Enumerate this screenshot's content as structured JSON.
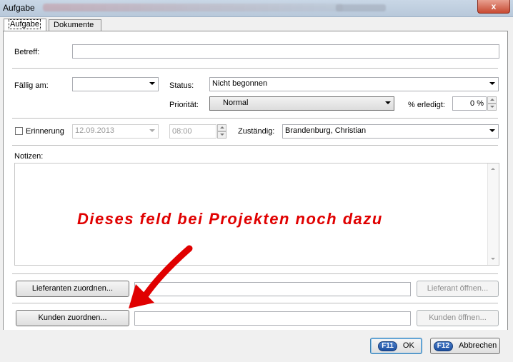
{
  "window": {
    "title": "Aufgabe",
    "close_label": "x"
  },
  "tabs": [
    {
      "label": "Aufgabe",
      "active": true
    },
    {
      "label": "Dokumente",
      "active": false
    }
  ],
  "form": {
    "betreff_label": "Betreff:",
    "betreff_value": "",
    "faellig_label": "Fällig am:",
    "faellig_value": "",
    "status_label": "Status:",
    "status_value": "Nicht begonnen",
    "prioritaet_label": "Priorität:",
    "prioritaet_value": "Normal",
    "erledigt_label": "% erledigt:",
    "erledigt_value": "0 %",
    "erinnerung_label": "Erinnerung",
    "erinnerung_checked": false,
    "erinnerung_date": "12.09.2013",
    "erinnerung_time": "08:00",
    "zustaendig_label": "Zuständig:",
    "zustaendig_value": "Brandenburg, Christian",
    "notizen_label": "Notizen:",
    "notizen_value": ""
  },
  "annotation": {
    "text": "Dieses feld bei Projekten noch dazu",
    "color": "#e00000"
  },
  "lieferanten": {
    "assign_label": "Lieferanten zuordnen...",
    "value": "",
    "open_label": "Lieferant öffnen..."
  },
  "kunden": {
    "assign_label": "Kunden zuordnen...",
    "value": "",
    "open_label": "Kunden öffnen..."
  },
  "footer": {
    "ok_key": "F11",
    "ok_label": "OK",
    "cancel_key": "F12",
    "cancel_label": "Abbrechen"
  }
}
